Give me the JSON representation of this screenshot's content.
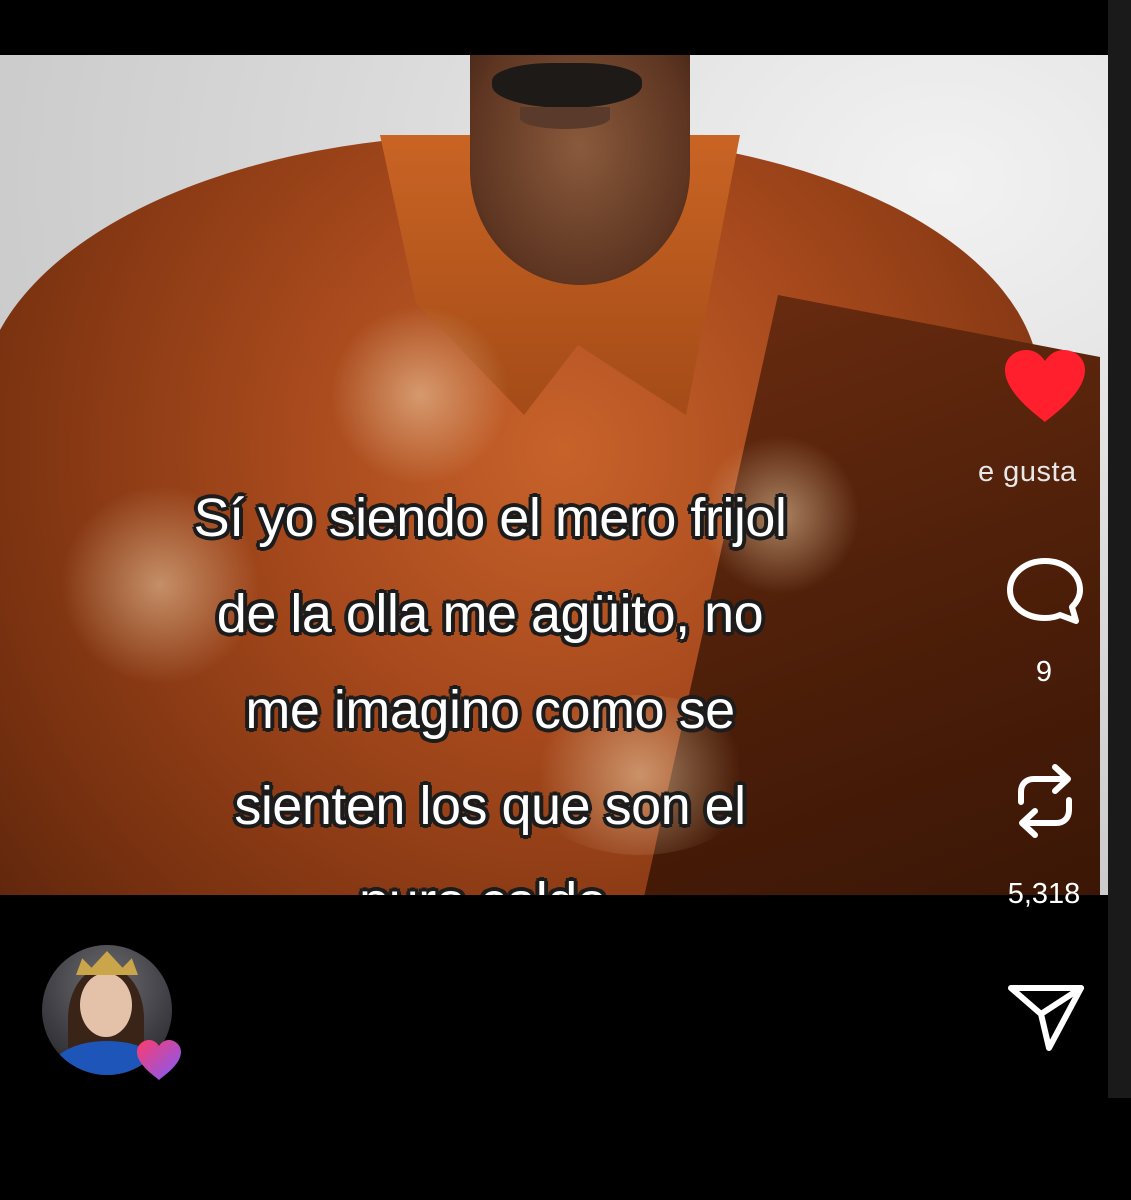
{
  "post": {
    "caption_lines": [
      "Sí yo siendo el mero frijol",
      "de la olla me agüito, no",
      "me imagino como se",
      "sienten los que son el",
      "puro caldo."
    ]
  },
  "actions": {
    "like": {
      "icon": "heart-filled-icon",
      "color": "#ff1f2d",
      "label": "e gusta"
    },
    "comment": {
      "icon": "comment-bubble-icon",
      "count": "9"
    },
    "repost": {
      "icon": "repost-icon",
      "count": "5,318"
    },
    "share": {
      "icon": "send-icon"
    }
  },
  "author": {
    "avatar_icon": "avatar",
    "badge_icon": "heart-gradient-icon",
    "badge_colors": [
      "#ff3b6b",
      "#7b5cff"
    ]
  }
}
